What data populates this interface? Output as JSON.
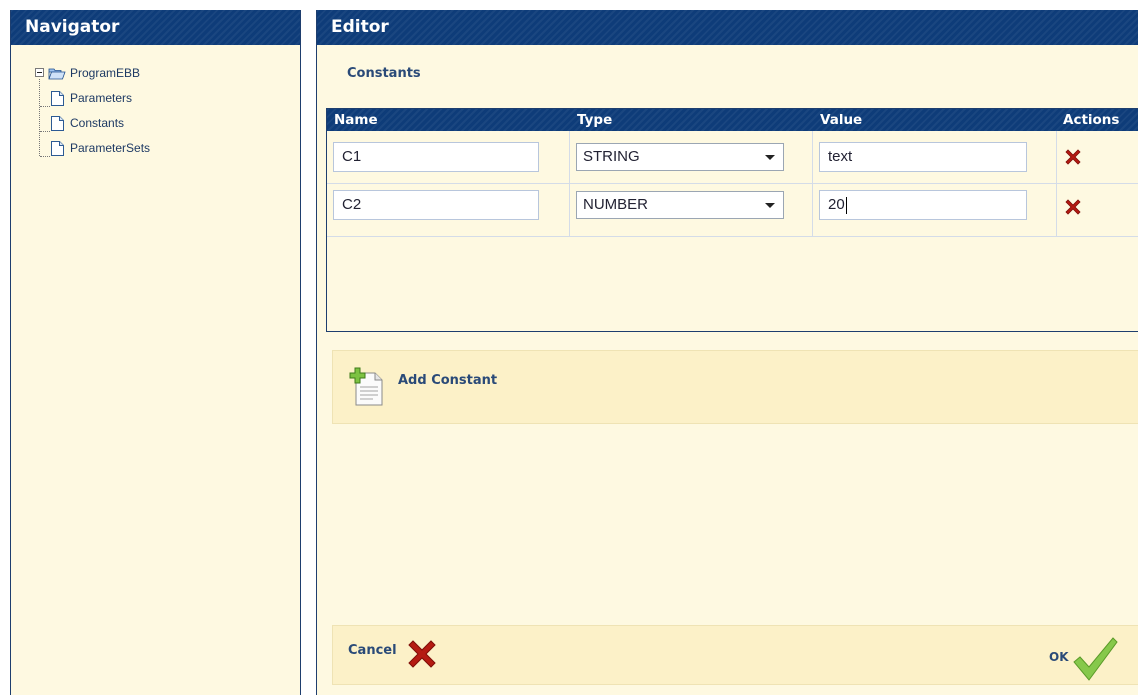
{
  "navigator": {
    "title": "Navigator",
    "tree": {
      "root": {
        "label": "ProgramEBB",
        "icon": "folder-open-icon",
        "expand_icon": "collapse-minus-icon"
      },
      "children": [
        {
          "label": "Parameters",
          "icon": "file-icon"
        },
        {
          "label": "Constants",
          "icon": "file-icon"
        },
        {
          "label": "ParameterSets",
          "icon": "file-icon"
        }
      ]
    }
  },
  "editor": {
    "title": "Editor",
    "section_title": "Constants",
    "table": {
      "columns": [
        "Name",
        "Type",
        "Value",
        "Actions"
      ],
      "rows": [
        {
          "name": "C1",
          "type": "STRING",
          "value": "text",
          "action_icon": "delete-x-icon"
        },
        {
          "name": "C2",
          "type": "NUMBER",
          "value": "20",
          "action_icon": "delete-x-icon"
        }
      ]
    },
    "add_button": {
      "label": "Add Constant",
      "icon": "add-document-icon"
    },
    "footer": {
      "cancel_label": "Cancel",
      "cancel_icon": "cancel-x-icon",
      "ok_label": "OK",
      "ok_icon": "checkmark-icon"
    }
  },
  "colors": {
    "header_blue": "#0e3c79",
    "panel_bg": "#fef9e1",
    "bar_bg": "#fcf1c8",
    "delete_red": "#b51b12",
    "ok_green": "#7ac143"
  }
}
